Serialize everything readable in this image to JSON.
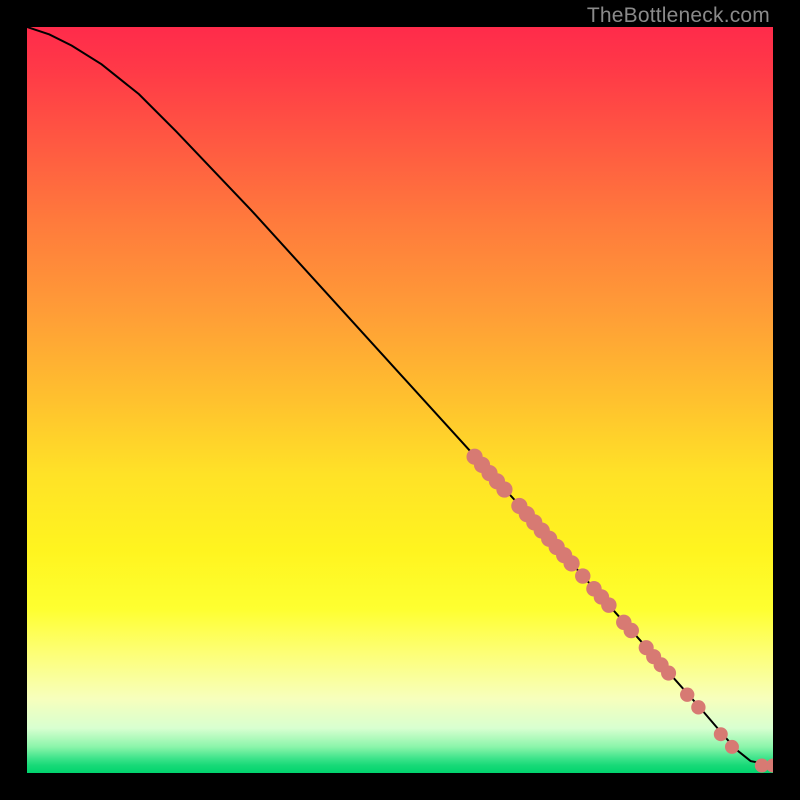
{
  "watermark": "TheBottleneck.com",
  "chart_data": {
    "type": "line",
    "title": "",
    "xlabel": "",
    "ylabel": "",
    "xlim": [
      0,
      100
    ],
    "ylim": [
      0,
      100
    ],
    "series": [
      {
        "name": "curve",
        "x": [
          0,
          3,
          6,
          10,
          15,
          20,
          30,
          40,
          50,
          60,
          70,
          78,
          82,
          86,
          90,
          93,
          95,
          97,
          100
        ],
        "y": [
          100,
          99,
          97.5,
          95,
          91,
          86,
          75.5,
          64.5,
          53.5,
          42.5,
          31.5,
          22.5,
          18,
          13.5,
          9,
          5.5,
          3.2,
          1.6,
          1.0
        ]
      }
    ],
    "markers": [
      {
        "x": 60.0,
        "y": 42.4,
        "r": 1.1
      },
      {
        "x": 61.0,
        "y": 41.3,
        "r": 1.1
      },
      {
        "x": 62.0,
        "y": 40.2,
        "r": 1.1
      },
      {
        "x": 63.0,
        "y": 39.1,
        "r": 1.1
      },
      {
        "x": 64.0,
        "y": 38.0,
        "r": 1.1
      },
      {
        "x": 66.0,
        "y": 35.8,
        "r": 1.1
      },
      {
        "x": 67.0,
        "y": 34.7,
        "r": 1.1
      },
      {
        "x": 68.0,
        "y": 33.6,
        "r": 1.1
      },
      {
        "x": 69.0,
        "y": 32.5,
        "r": 1.1
      },
      {
        "x": 70.0,
        "y": 31.4,
        "r": 1.1
      },
      {
        "x": 71.0,
        "y": 30.3,
        "r": 1.1
      },
      {
        "x": 72.0,
        "y": 29.2,
        "r": 1.1
      },
      {
        "x": 73.0,
        "y": 28.1,
        "r": 1.1
      },
      {
        "x": 74.5,
        "y": 26.4,
        "r": 1.0
      },
      {
        "x": 76.0,
        "y": 24.7,
        "r": 1.0
      },
      {
        "x": 77.0,
        "y": 23.6,
        "r": 1.0
      },
      {
        "x": 78.0,
        "y": 22.5,
        "r": 1.0
      },
      {
        "x": 80.0,
        "y": 20.2,
        "r": 1.0
      },
      {
        "x": 81.0,
        "y": 19.1,
        "r": 1.0
      },
      {
        "x": 83.0,
        "y": 16.8,
        "r": 0.95
      },
      {
        "x": 84.0,
        "y": 15.6,
        "r": 0.95
      },
      {
        "x": 85.0,
        "y": 14.5,
        "r": 0.95
      },
      {
        "x": 86.0,
        "y": 13.4,
        "r": 0.95
      },
      {
        "x": 88.5,
        "y": 10.5,
        "r": 0.85
      },
      {
        "x": 90.0,
        "y": 8.8,
        "r": 0.85
      },
      {
        "x": 93.0,
        "y": 5.2,
        "r": 0.8
      },
      {
        "x": 94.5,
        "y": 3.5,
        "r": 0.8
      },
      {
        "x": 98.5,
        "y": 1.0,
        "r": 0.8
      },
      {
        "x": 100.0,
        "y": 1.0,
        "r": 0.8
      }
    ],
    "background_gradient": {
      "top": "#ff2b4b",
      "mid": "#fff41f",
      "bottom": "#00d46e"
    }
  }
}
